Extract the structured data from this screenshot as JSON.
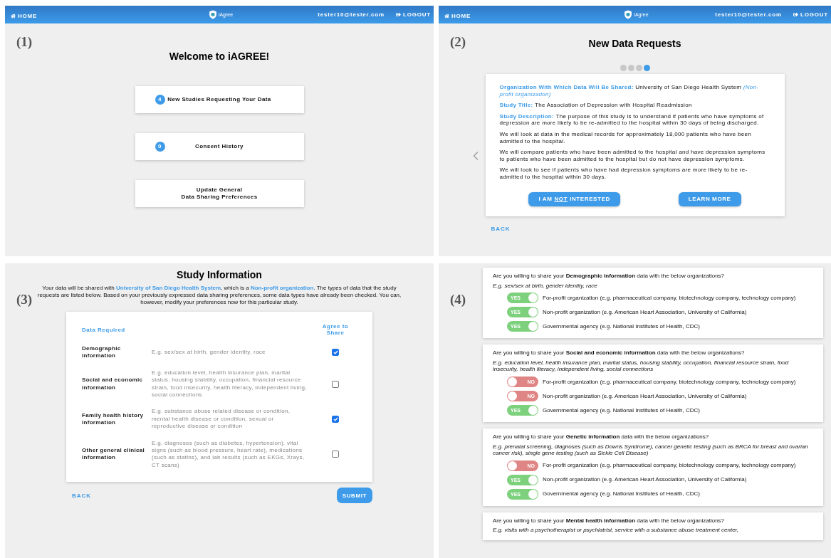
{
  "screens": [
    {
      "kind": "welcome",
      "number": "(1)",
      "nav": {
        "home": "HOME",
        "logo_text": "iAgree",
        "user": "tester10@tester.com",
        "logout": "LOGOUT"
      },
      "title": "Welcome to iAGREE!",
      "menu": [
        {
          "count": "4",
          "lines": [
            "New Studies Requesting Your Data"
          ]
        },
        {
          "count": "0",
          "lines": [
            "Consent History"
          ]
        },
        {
          "lines": [
            "Update General",
            "Data Sharing Preferences"
          ]
        }
      ]
    },
    {
      "kind": "requests",
      "number": "(2)",
      "nav": {
        "home": "HOME",
        "logo_text": "iAgree",
        "user": "tester10@tester.com",
        "logout": "LOGOUT"
      },
      "title": "New Data Requests",
      "dots": [
        {
          "selected": false
        },
        {
          "selected": false
        },
        {
          "selected": false
        },
        {
          "selected": true
        }
      ],
      "paragraphs": [
        {
          "label": "Organization With Which Data Will Be Shared:",
          "text": "University of San Diego Health System",
          "note": "(Non-profit organization)"
        },
        {
          "label": "Study Title:",
          "text": "The Association of Depression with Hospital Readmission"
        },
        {
          "label": "Study Description:",
          "text": "The purpose of this study is to understand if patients who have symptoms of depression are more likely to be re-admitted to the hospital within 30 days of being discharged."
        },
        {
          "text": "We will look at data in the medical records for approximately 18,000 patients who have been admitted to the hospital."
        },
        {
          "text": "We will compare patients who have been admitted to the hospital and have depression symptoms to patients who have been admitted to the hospital but do not have depression symptoms."
        },
        {
          "text": "We will look to see if patients who have had depression symptoms are more likely to be re-admitted to the hospital within 30 days."
        }
      ],
      "decline_button": {
        "before": "I AM",
        "emphasis": "NOT",
        "after": "INTERESTED"
      },
      "learn_button": "LEARN MORE",
      "back": "BACK"
    },
    {
      "kind": "study",
      "number": "(3)",
      "title": "Study Information",
      "intro": [
        {
          "kind": "plain",
          "text": "Your data will be shared with "
        },
        {
          "kind": "highlight",
          "text": "University of San Diego Health System"
        },
        {
          "kind": "plain",
          "text": ", which is a "
        },
        {
          "kind": "highlight",
          "text": "Non-profit organization"
        },
        {
          "kind": "plain",
          "text": ". The types of data that the study requests are listed below. Based on your previously expressed data sharing preferences, some data types have already been checked. You can, however, modify your preferences now for this particular study."
        }
      ],
      "columns": [
        "Data Required",
        "Agree to Share"
      ],
      "rows": [
        {
          "name": "Demographic information",
          "example": "E.g. sex/sex at birth, gender identity, race",
          "checked": true
        },
        {
          "name": "Social and economic information",
          "example": "E.g. education level, health insurance plan, marital status, housing stability, occupation, financial resource strain, food insecurity, health literacy, independent living, social connections",
          "checked": false
        },
        {
          "name": "Family health history information",
          "example": "E.g. substance abuse related disease or condition, mental health disease or condition, sexual or reproductive disease or condition",
          "checked": true
        },
        {
          "name": "Other general clinical information",
          "example": "E.g. diagnoses (such as diabetes, hypertension), vital signs (such as blood pressure, heart rate), medications (such as statins), and lab results (such as EKGs, Xrays, CT scans)",
          "checked": false
        }
      ],
      "back": "BACK",
      "submit": "SUBMIT"
    },
    {
      "kind": "preferences",
      "number": "(4)",
      "cards": [
        {
          "question": "Are you willing to share your **Demographic information** data with the below organizations?",
          "example": "E.g. sex/sex at birth, gender identity, race",
          "options": [
            {
              "on": true,
              "toggle": "YES",
              "label": "For-profit organization (e.g. pharmaceutical company, biotechnology company, technology company)"
            },
            {
              "on": true,
              "toggle": "YES",
              "label": "Non-profit organization (e.g. American Heart Association, University of California)"
            },
            {
              "on": true,
              "toggle": "YES",
              "label": "Governmental agency (e.g. National Institutes of Health, CDC)"
            }
          ]
        },
        {
          "question": "Are you willing to share your **Social and economic information** data with the below organizations?",
          "example": "E.g. education level, health insurance plan, marital status, housing stability, occupation, financial resource strain, food insecurity, health literacy, independent living, social connections",
          "options": [
            {
              "on": false,
              "toggle": "NO",
              "label": "For-profit organization (e.g. pharmaceutical company, biotechnology company, technology company)"
            },
            {
              "on": false,
              "toggle": "NO",
              "label": "Non-profit organization (e.g. American Heart Association, University of California)"
            },
            {
              "on": true,
              "toggle": "YES",
              "label": "Governmental agency (e.g. National Institutes of Health, CDC)"
            }
          ]
        },
        {
          "question": "Are you willing to share your **Genetic information** data with the below organizations?",
          "example": "E.g. prenatal screening, diagnoses (such as Downs Syndrome), cancer genetic testing (such as BRCA for breast and ovarian cancer risk), single gene testing (such as Sickle Cell Disease)",
          "options": [
            {
              "on": false,
              "toggle": "NO",
              "label": "For-profit organization (e.g. pharmaceutical company, biotechnology company, technology company)"
            },
            {
              "on": true,
              "toggle": "YES",
              "label": "Non-profit organization (e.g. American Heart Association, University of California)"
            },
            {
              "on": true,
              "toggle": "YES",
              "label": "Governmental agency (e.g. National Institutes of Health, CDC)"
            }
          ]
        },
        {
          "question": "Are you willing to share your **Mental health information** data with the below organizations?",
          "example": "E.g. visits with a psychotherapist or psychiatrist, service with a substance abuse treatment center,"
        }
      ]
    }
  ]
}
